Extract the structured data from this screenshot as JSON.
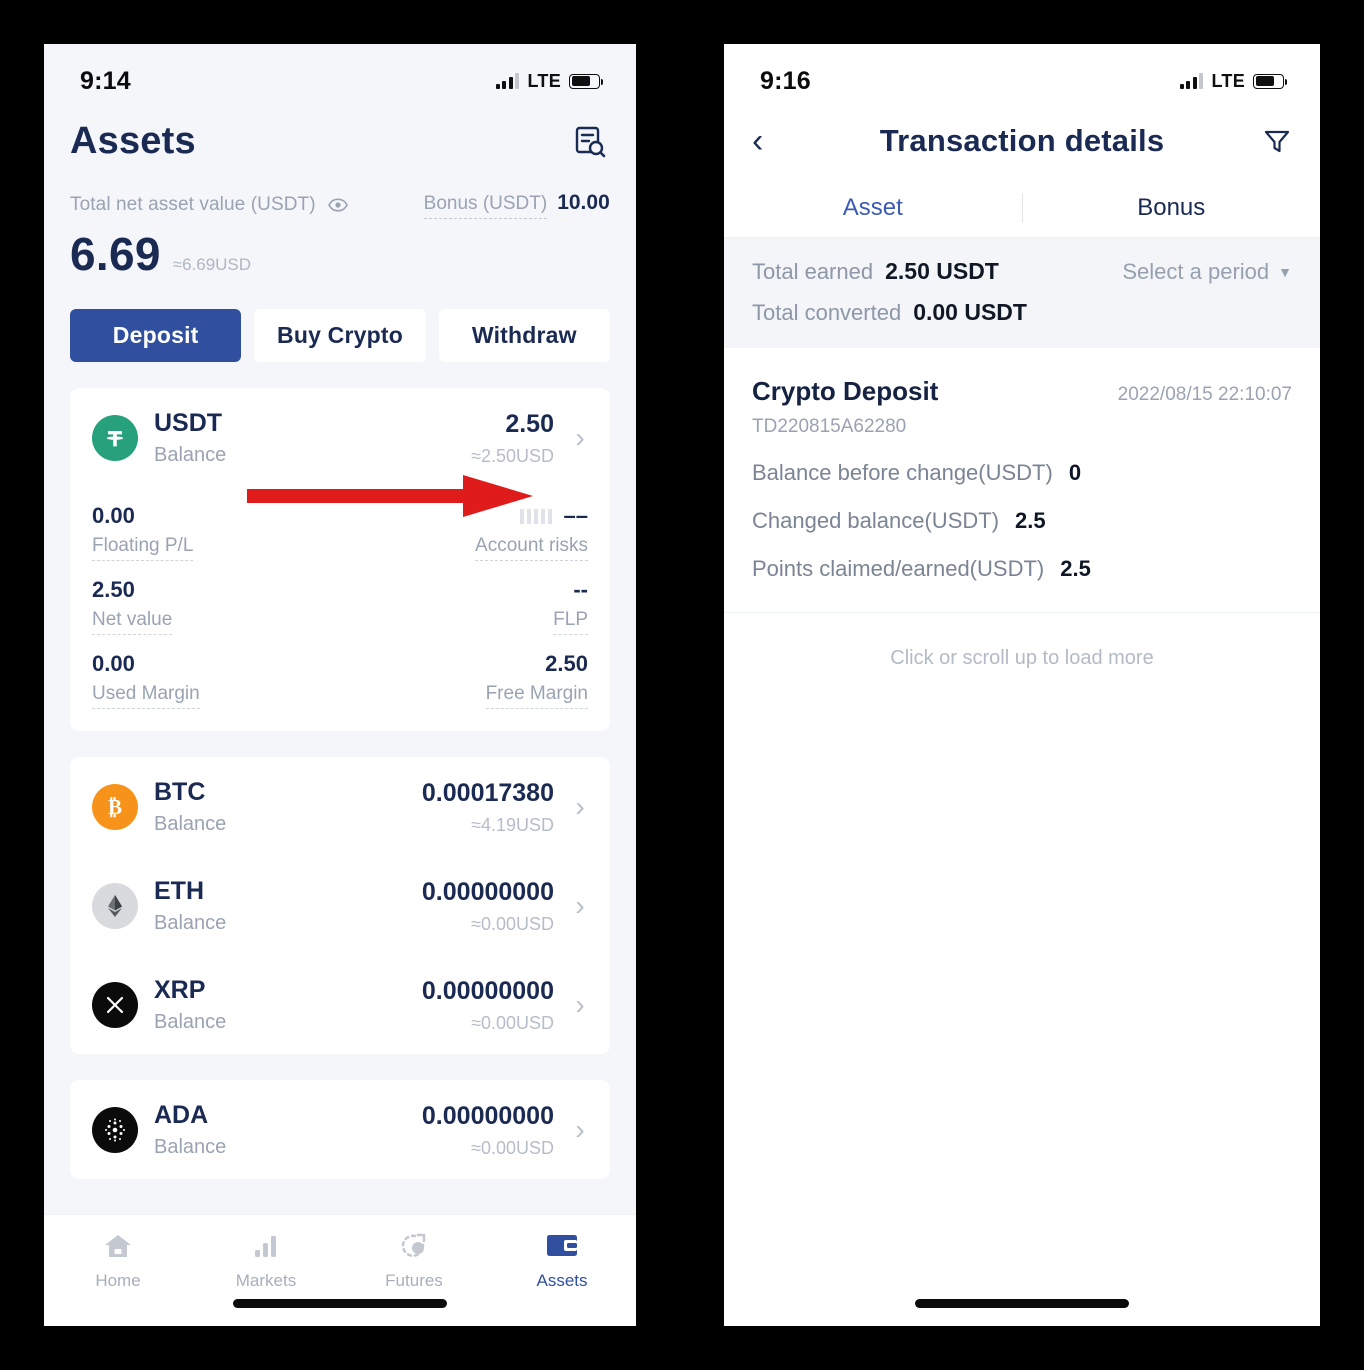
{
  "left_phone": {
    "status_bar": {
      "time": "9:14",
      "network": "LTE",
      "signal_icon": "signal-bars-icon",
      "battery_icon": "battery-icon"
    },
    "header": {
      "title": "Assets",
      "records_icon": "transaction-records-search-icon"
    },
    "summary": {
      "total_label": "Total net asset value (USDT)",
      "eye_icon": "eye-icon",
      "bonus_label": "Bonus (USDT)",
      "bonus_value": "10.00",
      "total_value": "6.69",
      "total_approx": "≈6.69USD"
    },
    "actions": {
      "deposit": "Deposit",
      "buy_crypto": "Buy Crypto",
      "withdraw": "Withdraw",
      "primary_color": "#30509f"
    },
    "usdt_card": {
      "symbol": "USDT",
      "icon": "tether-icon",
      "sub_label": "Balance",
      "amount": "2.50",
      "usd": "≈2.50USD",
      "chevron_icon": "chevron-right-icon",
      "stats": [
        {
          "value": "0.00",
          "label": "Floating P/L",
          "right_value": "––",
          "right_label": "Account risks",
          "right_has_bars": true
        },
        {
          "value": "2.50",
          "label": "Net value",
          "right_value": "--",
          "right_label": "FLP",
          "right_has_bars": false
        },
        {
          "value": "0.00",
          "label": "Used Margin",
          "right_value": "2.50",
          "right_label": "Free Margin",
          "right_has_bars": false
        }
      ]
    },
    "coins": [
      {
        "symbol": "BTC",
        "icon": "bitcoin-icon",
        "sub_label": "Balance",
        "amount": "0.00017380",
        "usd": "≈4.19USD"
      },
      {
        "symbol": "ETH",
        "icon": "ethereum-icon",
        "sub_label": "Balance",
        "amount": "0.00000000",
        "usd": "≈0.00USD"
      },
      {
        "symbol": "XRP",
        "icon": "ripple-icon",
        "sub_label": "Balance",
        "amount": "0.00000000",
        "usd": "≈0.00USD"
      },
      {
        "symbol": "ADA",
        "icon": "cardano-icon",
        "sub_label": "Balance",
        "amount": "0.00000000",
        "usd": "≈0.00USD"
      }
    ],
    "tabbar": [
      {
        "label": "Home",
        "icon": "home-icon",
        "active": false
      },
      {
        "label": "Markets",
        "icon": "bar-chart-icon",
        "active": false
      },
      {
        "label": "Futures",
        "icon": "futures-icon",
        "active": false
      },
      {
        "label": "Assets",
        "icon": "wallet-icon",
        "active": true
      }
    ],
    "annotation": {
      "arrow_icon": "red-arrow-right",
      "arrow_color": "#e01b1b"
    }
  },
  "right_phone": {
    "status_bar": {
      "time": "9:16",
      "network": "LTE",
      "signal_icon": "signal-bars-icon",
      "battery_icon": "battery-icon"
    },
    "nav": {
      "back_icon": "chevron-left-icon",
      "title": "Transaction details",
      "filter_icon": "filter-funnel-icon"
    },
    "tabs": [
      {
        "label": "Asset",
        "active": true
      },
      {
        "label": "Bonus",
        "active": false
      }
    ],
    "summary": {
      "total_earned_label": "Total earned",
      "total_earned_value": "2.50 USDT",
      "total_converted_label": "Total converted",
      "total_converted_value": "0.00 USDT",
      "period_label": "Select a period",
      "period_caret_icon": "caret-down-icon"
    },
    "transaction": {
      "title": "Crypto Deposit",
      "date": "2022/08/15 22:10:07",
      "id": "TD220815A62280",
      "rows": [
        {
          "key": "Balance before change(USDT)",
          "value": "0"
        },
        {
          "key": "Changed balance(USDT)",
          "value": "2.5"
        },
        {
          "key": "Points claimed/earned(USDT)",
          "value": "2.5"
        }
      ]
    },
    "load_more": "Click or scroll up to load more"
  }
}
